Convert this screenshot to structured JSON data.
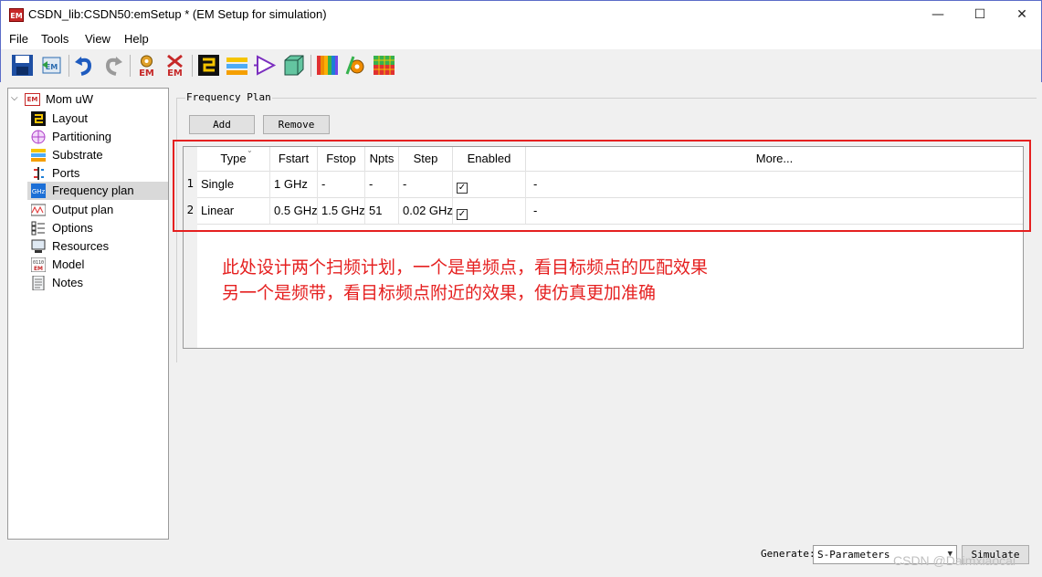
{
  "window": {
    "title": "CSDN_lib:CSDN50:emSetup * (EM Setup for simulation)",
    "icon_text": "EM",
    "minimize_glyph": "—",
    "maximize_glyph": "☐",
    "close_glyph": "✕"
  },
  "menu": [
    "File",
    "Tools",
    "View",
    "Help"
  ],
  "toolbar": {
    "icons": [
      "save-icon",
      "export-em-icon",
      "undo-icon",
      "redo-icon",
      "em-gear-icon",
      "em-disable-icon",
      "layout-icon",
      "substrate-icon",
      "port-triangle-icon",
      "box-3d-icon",
      "spectrum-icon",
      "tune-gear-icon",
      "mesh-icon"
    ],
    "em_text": "EM"
  },
  "tree": {
    "root": "Mom uW",
    "root_icon_text": "EM",
    "items": [
      {
        "label": "Layout",
        "icon": "layout-icon"
      },
      {
        "label": "Partitioning",
        "icon": "partitioning-icon"
      },
      {
        "label": "Substrate",
        "icon": "substrate-icon"
      },
      {
        "label": "Ports",
        "icon": "ports-icon"
      },
      {
        "label": "Frequency plan",
        "icon": "ghz-icon",
        "selected": true
      },
      {
        "label": "Output plan",
        "icon": "output-plan-icon"
      },
      {
        "label": "Options",
        "icon": "options-icon"
      },
      {
        "label": "Resources",
        "icon": "resources-icon"
      },
      {
        "label": "Model",
        "icon": "model-icon"
      },
      {
        "label": "Notes",
        "icon": "notes-icon"
      }
    ],
    "ghz_text": "GHz"
  },
  "frequency_plan": {
    "group_title": "Frequency Plan",
    "add_label": "Add",
    "remove_label": "Remove",
    "columns": [
      "Type",
      "Fstart",
      "Fstop",
      "Npts",
      "Step",
      "Enabled",
      "More..."
    ],
    "rows": [
      {
        "num": "1",
        "type": "Single",
        "fstart": "1 GHz",
        "fstop": "-",
        "npts": "-",
        "step": "-",
        "enabled": true,
        "more": "-"
      },
      {
        "num": "2",
        "type": "Linear",
        "fstart": "0.5 GHz",
        "fstop": "1.5 GHz",
        "npts": "51",
        "step": "0.02 GHz",
        "enabled": true,
        "more": "-"
      }
    ],
    "check_glyph": "✓"
  },
  "annotation": {
    "line1": "此处设计两个扫频计划，一个是单频点，看目标频点的匹配效果",
    "line2": "另一个是频带，看目标频点附近的效果，使仿真更加准确",
    "color": "#e52020"
  },
  "footer": {
    "generate_label": "Generate:",
    "generate_value": "S-Parameters",
    "simulate_label": "Simulate"
  },
  "watermark": "CSDN @Daimxiaocai"
}
